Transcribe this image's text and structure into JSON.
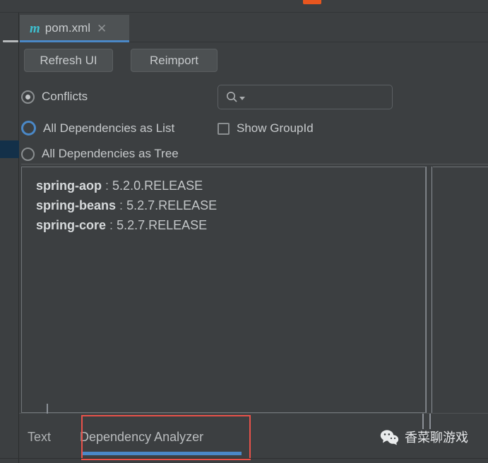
{
  "window": {
    "collapse_icon": "minimize-icon",
    "accent_blue": "#4a88c7",
    "annotation_red": "#e8524a",
    "background": "#3c3f41"
  },
  "editor_tab": {
    "icon": "maven-m-icon",
    "icon_glyph": "m",
    "title": "pom.xml",
    "close_glyph": "✕"
  },
  "toolbar": {
    "refresh_label": "Refresh UI",
    "reimport_label": "Reimport"
  },
  "search": {
    "icon": "search-icon",
    "value": "",
    "placeholder": ""
  },
  "options": {
    "conflicts": {
      "label": "Conflicts",
      "selected": true
    },
    "all_as_list": {
      "label": "All Dependencies as List",
      "selected": false,
      "focused": true
    },
    "all_as_tree": {
      "label": "All Dependencies as Tree",
      "selected": false
    },
    "show_groupid": {
      "label": "Show GroupId",
      "checked": false
    }
  },
  "dependencies": [
    {
      "name": "spring-aop",
      "separator": ":",
      "version": "5.2.0.RELEASE"
    },
    {
      "name": "spring-beans",
      "separator": ":",
      "version": "5.2.7.RELEASE"
    },
    {
      "name": "spring-core",
      "separator": ":",
      "version": "5.2.7.RELEASE"
    }
  ],
  "bottom_tabs": [
    {
      "label": "Text",
      "active": false
    },
    {
      "label": "Dependency Analyzer",
      "active": true
    }
  ],
  "watermark": {
    "icon": "wechat-icon",
    "text": "香菜聊游戏"
  }
}
